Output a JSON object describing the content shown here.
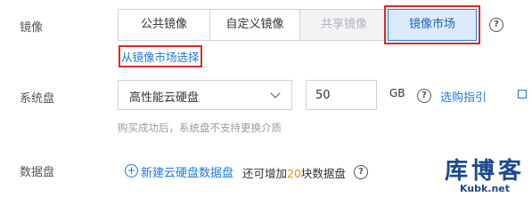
{
  "image": {
    "label": "镜像",
    "tabs": [
      "公共镜像",
      "自定义镜像",
      "共享镜像",
      "镜像市场"
    ],
    "active_tab": "镜像市场",
    "disabled_tab": "共享镜像",
    "market_link": "从镜像市场选择"
  },
  "system_disk": {
    "label": "系统盘",
    "type_value": "高性能云硬盘",
    "size_value": "50",
    "unit": "GB",
    "guide_link": "选购指引",
    "hint": "购买成功后，系统盘不支持更换介质"
  },
  "data_disk": {
    "label": "数据盘",
    "add_link": "新建云硬盘数据盘",
    "text_prefix": "还可增加",
    "count": "20",
    "text_suffix": "块数据盘"
  },
  "watermark": {
    "big": "库博客",
    "small": "Kubk.net"
  },
  "colors": {
    "accent": "#1f7ad9",
    "highlight_box": "#d92929",
    "active_bg": "#dcebfb",
    "count": "#e8900c"
  }
}
